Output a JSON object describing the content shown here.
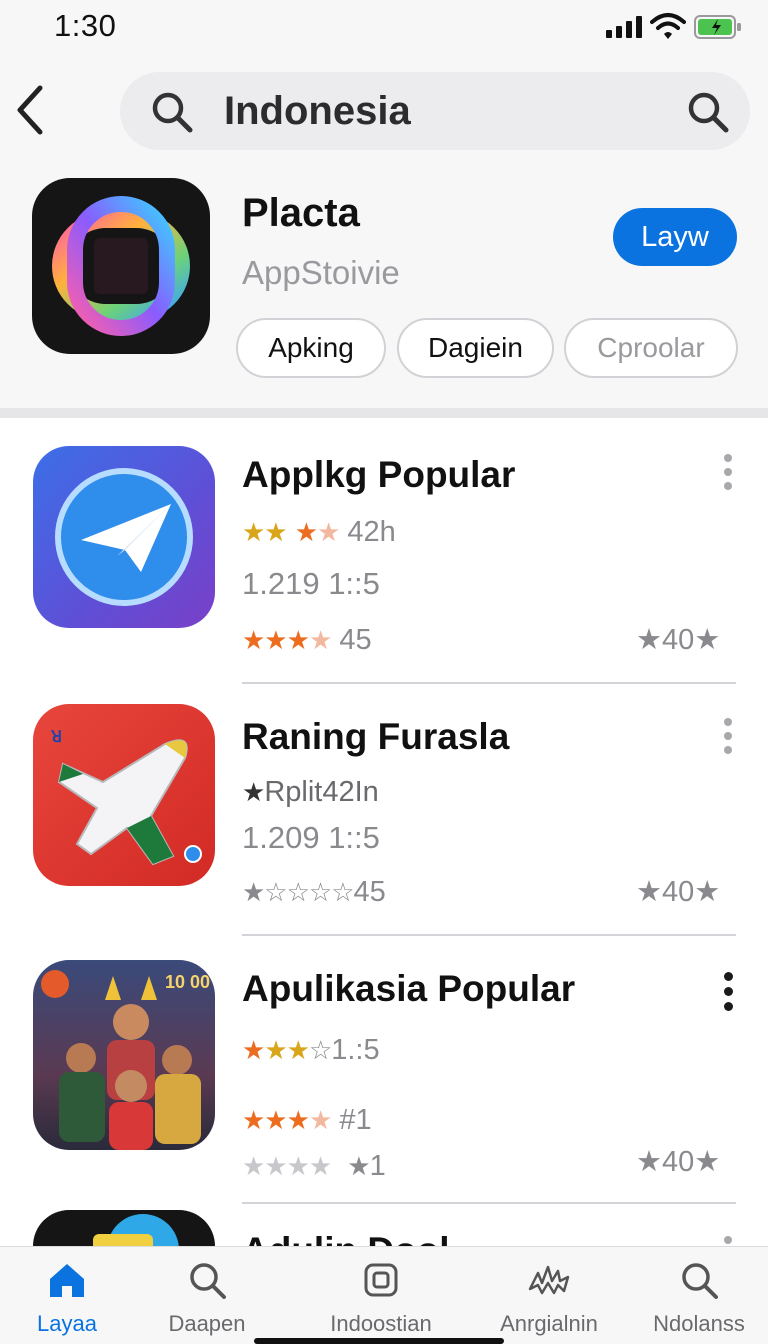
{
  "status_bar": {
    "time": "1:30"
  },
  "search": {
    "query": "Indonesia"
  },
  "featured": {
    "title": "Placta",
    "subtitle": "AppStoivie",
    "get_label": "Layw",
    "chips": [
      "Apking",
      "Dagiein",
      "Cproolar"
    ]
  },
  "apps": [
    {
      "title": "Applkg Popular",
      "rating_line": "42h",
      "stat_line": "1.219 1::5",
      "rating2_line": "45",
      "score": "40"
    },
    {
      "title": "Raning Furasla",
      "rating_line": "Rplit42In",
      "stat_line": "1.209 1::5",
      "rating2_line": "45",
      "score": "40"
    },
    {
      "title": "Apulikasia Popular",
      "rating_line": "1.:5",
      "stat_line": "#1",
      "rating2_line": "1",
      "score": "40"
    },
    {
      "title": "Adulin Dool"
    }
  ],
  "tabs": [
    {
      "label": "Layaa",
      "icon": "home-icon",
      "active": true
    },
    {
      "label": "Daapen",
      "icon": "search-icon"
    },
    {
      "label": "Indoostian",
      "icon": "apps-icon"
    },
    {
      "label": "Anrgialnin",
      "icon": "arcade-icon"
    },
    {
      "label": "Ndolanss",
      "icon": "search-icon"
    }
  ],
  "colors": {
    "accent": "#0a73e0",
    "star_orange": "#ec6d1f",
    "star_yellow": "#d9a51b"
  }
}
